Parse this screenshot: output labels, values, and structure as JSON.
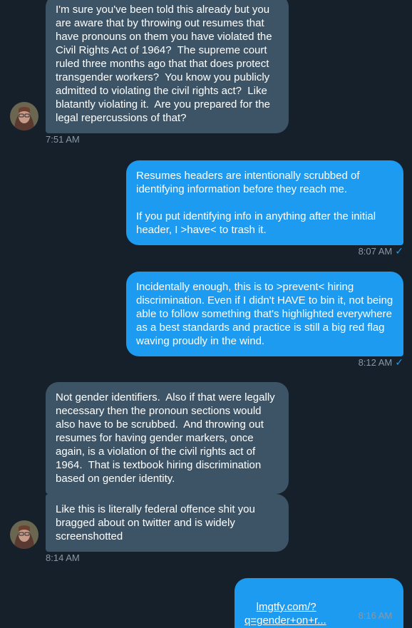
{
  "messages": [
    {
      "text": "I'm sure you've been told this already but you are aware that by throwing out resumes that have pronouns on them you have violated the Civil Rights Act of 1964?  The supreme court ruled three months ago that that does protect transgender workers?  You know you publicly admitted to violating the civil rights act?  Like blatantly violating it.  Are you prepared for the legal repercussions of that?"
    },
    {
      "text": "Resumes headers are intentionally scrubbed of identifying information before they reach me.\n\nIf you put identifying info in anything after the initial header, I >have< to trash it."
    },
    {
      "text": "Incidentally enough, this is to >prevent< hiring discrimination. Even if I didn't HAVE to bin it, not being able to follow something that's highlighted everywhere as a best standards and practice is still a big red flag waving proudly in the wind."
    },
    {
      "text": "Not gender identifiers.  Also if that were legally necessary then the pronoun sections would also have to be scrubbed.  And throwing out resumes for having gender markers, once again, is a violation of the civil rights act of 1964.  That is textbook hiring discrimination based on gender identity."
    },
    {
      "text": "Like this is literally federal offence shit you bragged about on twitter and is widely screenshotted"
    },
    {
      "text": "lmgtfy.com/?q=gender+on+r..."
    }
  ],
  "timestamps": {
    "t1": "7:51 AM",
    "t2": "8:07 AM",
    "t3": "8:12 AM",
    "t4": "8:14 AM",
    "t5": "8:16 AM"
  },
  "read_check": "✓",
  "colors": {
    "background": "#15202b",
    "received_bubble": "#3d5466",
    "sent_bubble": "#1d9bf0",
    "timestamp": "#8b98a5"
  }
}
